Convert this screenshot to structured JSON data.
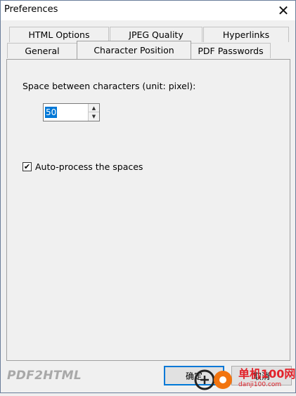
{
  "window": {
    "title": "Preferences",
    "close_glyph": "✕"
  },
  "tabs": {
    "row1": [
      {
        "label": "HTML Options"
      },
      {
        "label": "JPEG Quality"
      },
      {
        "label": "Hyperlinks"
      }
    ],
    "row2": [
      {
        "label": "General"
      },
      {
        "label": "Character Position",
        "active": true
      },
      {
        "label": "PDF Passwords"
      }
    ]
  },
  "character_position": {
    "spacing_label": "Space between characters (unit: pixel):",
    "spacing_value": "50",
    "auto_process_checked": true,
    "auto_process_label": "Auto-process the spaces"
  },
  "footer": {
    "brand": "PDF2HTML",
    "ok_label": "确定",
    "cancel_label": "取消"
  },
  "watermark": {
    "site_name": "单机100网",
    "site_url": "danji100.com"
  },
  "colors": {
    "accent": "#0078d7",
    "watermark": "#e2222a"
  }
}
